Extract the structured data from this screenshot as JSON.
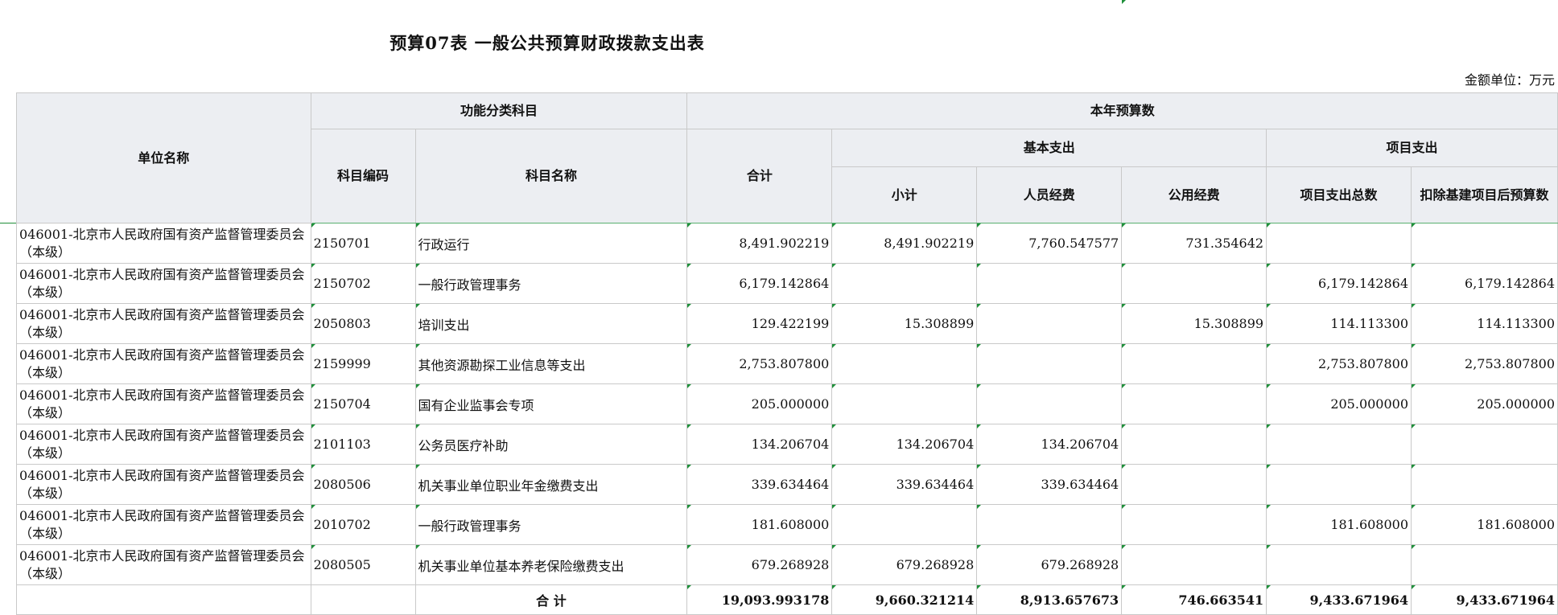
{
  "title": "预算07表  一般公共预算财政拨款支出表",
  "unit_label": "金额单位：万元",
  "headers": {
    "unit_name": "单位名称",
    "func_category": "功能分类科目",
    "budget_this_year": "本年预算数",
    "subject_code": "科目编码",
    "subject_name": "科目名称",
    "total": "合计",
    "basic_expense": "基本支出",
    "project_expense": "项目支出",
    "subtotal": "小计",
    "personnel": "人员经费",
    "public_funds": "公用经费",
    "project_total": "项目支出总数",
    "project_ex_capital": "扣除基建项目后预算数"
  },
  "rows": [
    {
      "unit": "046001-北京市人民政府国有资产监督管理委员会（本级）",
      "code": "2150701",
      "name": "行政运行",
      "total": "8,491.902219",
      "subtotal": "8,491.902219",
      "personnel": "7,760.547577",
      "public": "731.354642",
      "proj_total": "",
      "proj_ex": ""
    },
    {
      "unit": "046001-北京市人民政府国有资产监督管理委员会（本级）",
      "code": "2150702",
      "name": "一般行政管理事务",
      "total": "6,179.142864",
      "subtotal": "",
      "personnel": "",
      "public": "",
      "proj_total": "6,179.142864",
      "proj_ex": "6,179.142864"
    },
    {
      "unit": "046001-北京市人民政府国有资产监督管理委员会（本级）",
      "code": "2050803",
      "name": "培训支出",
      "total": "129.422199",
      "subtotal": "15.308899",
      "personnel": "",
      "public": "15.308899",
      "proj_total": "114.113300",
      "proj_ex": "114.113300"
    },
    {
      "unit": "046001-北京市人民政府国有资产监督管理委员会（本级）",
      "code": "2159999",
      "name": "其他资源勘探工业信息等支出",
      "total": "2,753.807800",
      "subtotal": "",
      "personnel": "",
      "public": "",
      "proj_total": "2,753.807800",
      "proj_ex": "2,753.807800"
    },
    {
      "unit": "046001-北京市人民政府国有资产监督管理委员会（本级）",
      "code": "2150704",
      "name": "国有企业监事会专项",
      "total": "205.000000",
      "subtotal": "",
      "personnel": "",
      "public": "",
      "proj_total": "205.000000",
      "proj_ex": "205.000000"
    },
    {
      "unit": "046001-北京市人民政府国有资产监督管理委员会（本级）",
      "code": "2101103",
      "name": "公务员医疗补助",
      "total": "134.206704",
      "subtotal": "134.206704",
      "personnel": "134.206704",
      "public": "",
      "proj_total": "",
      "proj_ex": ""
    },
    {
      "unit": "046001-北京市人民政府国有资产监督管理委员会（本级）",
      "code": "2080506",
      "name": "机关事业单位职业年金缴费支出",
      "total": "339.634464",
      "subtotal": "339.634464",
      "personnel": "339.634464",
      "public": "",
      "proj_total": "",
      "proj_ex": ""
    },
    {
      "unit": "046001-北京市人民政府国有资产监督管理委员会（本级）",
      "code": "2010702",
      "name": "一般行政管理事务",
      "total": "181.608000",
      "subtotal": "",
      "personnel": "",
      "public": "",
      "proj_total": "181.608000",
      "proj_ex": "181.608000"
    },
    {
      "unit": "046001-北京市人民政府国有资产监督管理委员会（本级）",
      "code": "2080505",
      "name": "机关事业单位基本养老保险缴费支出",
      "total": "679.268928",
      "subtotal": "679.268928",
      "personnel": "679.268928",
      "public": "",
      "proj_total": "",
      "proj_ex": ""
    }
  ],
  "totals": {
    "label": "合    计",
    "total": "19,093.993178",
    "subtotal": "9,660.321214",
    "personnel": "8,913.657673",
    "public": "746.663541",
    "proj_total": "9,433.671964",
    "proj_ex": "9,433.671964"
  }
}
